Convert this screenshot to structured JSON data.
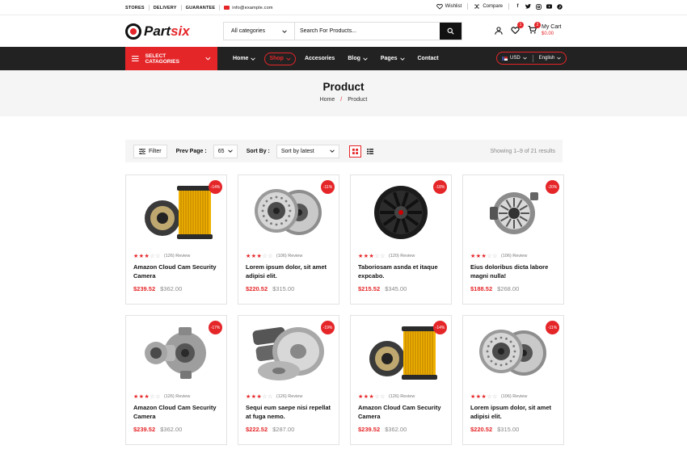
{
  "topbar": {
    "links": [
      "STORES",
      "DELIVERY",
      "GUARANTEE"
    ],
    "email": "info@example.com",
    "wishlist": "Wishlist",
    "compare": "Compare",
    "social": [
      "facebook-icon",
      "twitter-icon",
      "instagram-icon",
      "youtube-icon",
      "pinterest-icon"
    ]
  },
  "header": {
    "logo_main": "Part",
    "logo_accent": "six",
    "search_category": "All categories",
    "search_placeholder": "Search For Products...",
    "wishlist_count": "1",
    "cart_count": "2",
    "cart_label": "My Cart",
    "cart_amount": "$0.00"
  },
  "nav": {
    "categories_button": "SELECT CATAGORIES",
    "items": [
      "Home",
      "Shop",
      "Accesories",
      "Blog",
      "Pages",
      "Contact"
    ],
    "active": "Shop",
    "currency": "USD",
    "language": "English"
  },
  "banner": {
    "title": "Product",
    "crumb_home": "Home",
    "crumb_current": "Product"
  },
  "toolbar": {
    "filter_label": "Filter",
    "per_page_label": "Prev Page :",
    "per_page_value": "65",
    "sort_label": "Sort By :",
    "sort_value": "Sort by latest",
    "showing": "Showing 1–9 of 21 results"
  },
  "colors": {
    "accent": "#e52629",
    "dark": "#222222"
  },
  "products": [
    {
      "name": "Amazon Cloud Cam Security Camera",
      "price": "$239.52",
      "old_price": "$362.00",
      "discount": "-14%",
      "reviews": "(126) Review",
      "rating": 3,
      "image": "oil-filter"
    },
    {
      "name": "Lorem ipsum dolor, sit amet adipisi elit.",
      "price": "$220.52",
      "old_price": "$315.00",
      "discount": "-11%",
      "reviews": "(106) Review",
      "rating": 3,
      "image": "brake-discs"
    },
    {
      "name": "Taboriosam asnda et itaque expcabo.",
      "price": "$215.52",
      "old_price": "$345.00",
      "discount": "-18%",
      "reviews": "(120) Review",
      "rating": 3,
      "image": "wheel-rim"
    },
    {
      "name": "Eius doloribus dicta labore magni nulla!",
      "price": "$188.52",
      "old_price": "$268.00",
      "discount": "-20%",
      "reviews": "(106) Review",
      "rating": 3,
      "image": "alternator"
    },
    {
      "name": "Amazon Cloud Cam Security Camera",
      "price": "$239.52",
      "old_price": "$362.00",
      "discount": "-17%",
      "reviews": "(126) Review",
      "rating": 3,
      "image": "turbocharger"
    },
    {
      "name": "Sequi eum saepe nisi repellat at fuga nemo.",
      "price": "$222.52",
      "old_price": "$287.00",
      "discount": "-19%",
      "reviews": "(126) Review",
      "rating": 3,
      "image": "brake-kit"
    },
    {
      "name": "Amazon Cloud Cam Security Camera",
      "price": "$239.52",
      "old_price": "$362.00",
      "discount": "-14%",
      "reviews": "(126) Review",
      "rating": 3,
      "image": "oil-filter"
    },
    {
      "name": "Lorem ipsum dolor, sit amet adipisi elit.",
      "price": "$220.52",
      "old_price": "$315.00",
      "discount": "-11%",
      "reviews": "(106) Review",
      "rating": 3,
      "image": "brake-discs"
    }
  ]
}
